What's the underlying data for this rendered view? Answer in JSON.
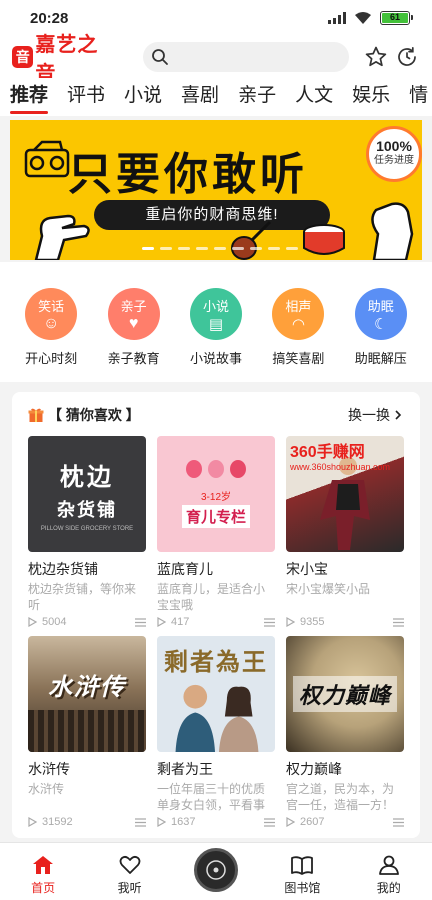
{
  "status_bar": {
    "time": "20:28",
    "battery": "61"
  },
  "app": {
    "logo_mark": "音",
    "logo_text": "嘉艺之音"
  },
  "tabs": [
    "推荐",
    "评书",
    "小说",
    "喜剧",
    "亲子",
    "人文",
    "娱乐",
    "情"
  ],
  "banner": {
    "title": "只要你敢听",
    "subtitle": "重启你的财商思维!",
    "badge_pct": "100%",
    "badge_label": "任务进度"
  },
  "channels": [
    {
      "icon_text": "笑话",
      "label": "开心时刻",
      "color": "#ff8a5b"
    },
    {
      "icon_text": "亲子",
      "label": "亲子教育",
      "color": "#ff7e6b"
    },
    {
      "icon_text": "小说",
      "label": "小说故事",
      "color": "#3fc59a"
    },
    {
      "icon_text": "相声",
      "label": "搞笑喜剧",
      "color": "#ffa03a"
    },
    {
      "icon_text": "助眠",
      "label": "助眠解压",
      "color": "#5a8ff5"
    }
  ],
  "guess": {
    "title": "【 猜你喜欢 】",
    "refresh": "换一换",
    "items": [
      {
        "title": "枕边杂货铺",
        "desc": "枕边杂货铺，等你来听",
        "plays": "5004",
        "cover_text": "枕边",
        "cover_text2": "杂货铺",
        "cover_sub": "PILLOW SIDE GROCERY STORE",
        "cover_bg": "#3a3a3d"
      },
      {
        "title": "蓝底育儿",
        "desc": "蓝底育儿，是适合小宝宝哦",
        "plays": "417",
        "cover_text": "3-12岁",
        "cover_text2": "育儿专栏",
        "cover_bg": "#f9c7d2"
      },
      {
        "title": "宋小宝",
        "desc": "宋小宝爆笑小品",
        "plays": "9355",
        "cover_bg": "#8a2b2b"
      },
      {
        "title": "水浒传",
        "desc": "水浒传",
        "plays": "31592",
        "cover_text": "水浒传",
        "cover_bg": "#6e5a45"
      },
      {
        "title": "剩者为王",
        "desc": "一位年届三十的优质单身女白领，平看事业有",
        "plays": "1637",
        "cover_text": "剩者為王",
        "cover_bg": "#dfe7ee"
      },
      {
        "title": "权力巅峰",
        "desc": "官之道，民为本，为官一任，造福一方！军人",
        "plays": "2607",
        "cover_text": "权力巅峰",
        "cover_bg": "#b7a27a"
      }
    ]
  },
  "watermark": {
    "title": "360手赚网",
    "url": "www.360shouzhuan.com"
  },
  "player": {
    "text": "勿扰\n模式"
  },
  "nav": [
    {
      "label": "首页",
      "icon": "home-icon"
    },
    {
      "label": "我听",
      "icon": "heart-icon"
    },
    {
      "label": "",
      "icon": "player-icon"
    },
    {
      "label": "图书馆",
      "icon": "book-icon"
    },
    {
      "label": "我的",
      "icon": "user-icon"
    }
  ]
}
